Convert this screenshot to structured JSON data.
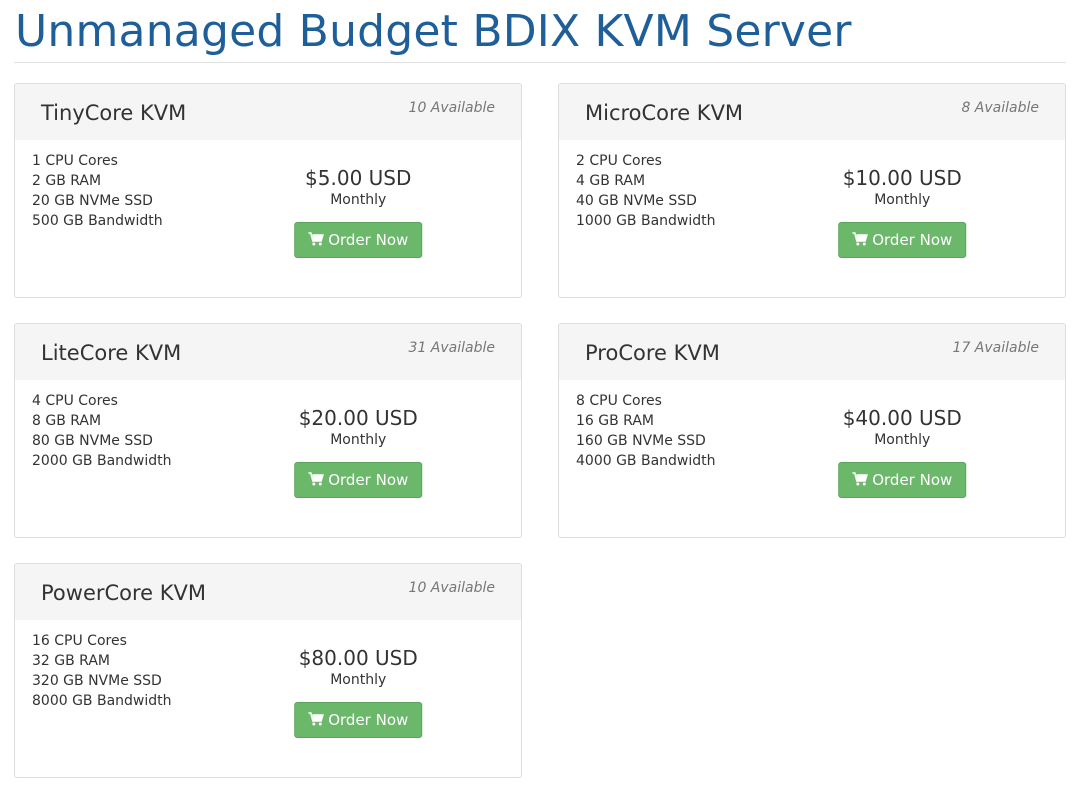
{
  "page": {
    "title": "Unmanaged Budget BDIX KVM Server"
  },
  "colors": {
    "title": "#1f5f99",
    "button": "#6cb86a",
    "header_bg": "#f5f5f5"
  },
  "products": [
    {
      "name": "TinyCore KVM",
      "availability": "10 Available",
      "features": [
        "1 CPU Cores",
        "2 GB RAM",
        "20 GB NVMe SSD",
        "500 GB Bandwidth"
      ],
      "price": "$5.00 USD",
      "cycle": "Monthly",
      "button_label": "Order Now",
      "button_icon": "shopping-cart-icon"
    },
    {
      "name": "MicroCore KVM",
      "availability": "8 Available",
      "features": [
        "2 CPU Cores",
        "4 GB RAM",
        "40 GB NVMe SSD",
        "1000 GB Bandwidth"
      ],
      "price": "$10.00 USD",
      "cycle": "Monthly",
      "button_label": "Order Now",
      "button_icon": "shopping-cart-icon"
    },
    {
      "name": "LiteCore KVM",
      "availability": "31 Available",
      "features": [
        "4 CPU Cores",
        "8 GB RAM",
        "80 GB NVMe SSD",
        "2000 GB Bandwidth"
      ],
      "price": "$20.00 USD",
      "cycle": "Monthly",
      "button_label": "Order Now",
      "button_icon": "shopping-cart-icon"
    },
    {
      "name": "ProCore KVM",
      "availability": "17 Available",
      "features": [
        "8 CPU Cores",
        "16 GB RAM",
        "160 GB NVMe SSD",
        "4000 GB Bandwidth"
      ],
      "price": "$40.00 USD",
      "cycle": "Monthly",
      "button_label": "Order Now",
      "button_icon": "shopping-cart-icon"
    },
    {
      "name": "PowerCore KVM",
      "availability": "10 Available",
      "features": [
        "16 CPU Cores",
        "32 GB RAM",
        "320 GB NVMe SSD",
        "8000 GB Bandwidth"
      ],
      "price": "$80.00 USD",
      "cycle": "Monthly",
      "button_label": "Order Now",
      "button_icon": "shopping-cart-icon"
    }
  ]
}
